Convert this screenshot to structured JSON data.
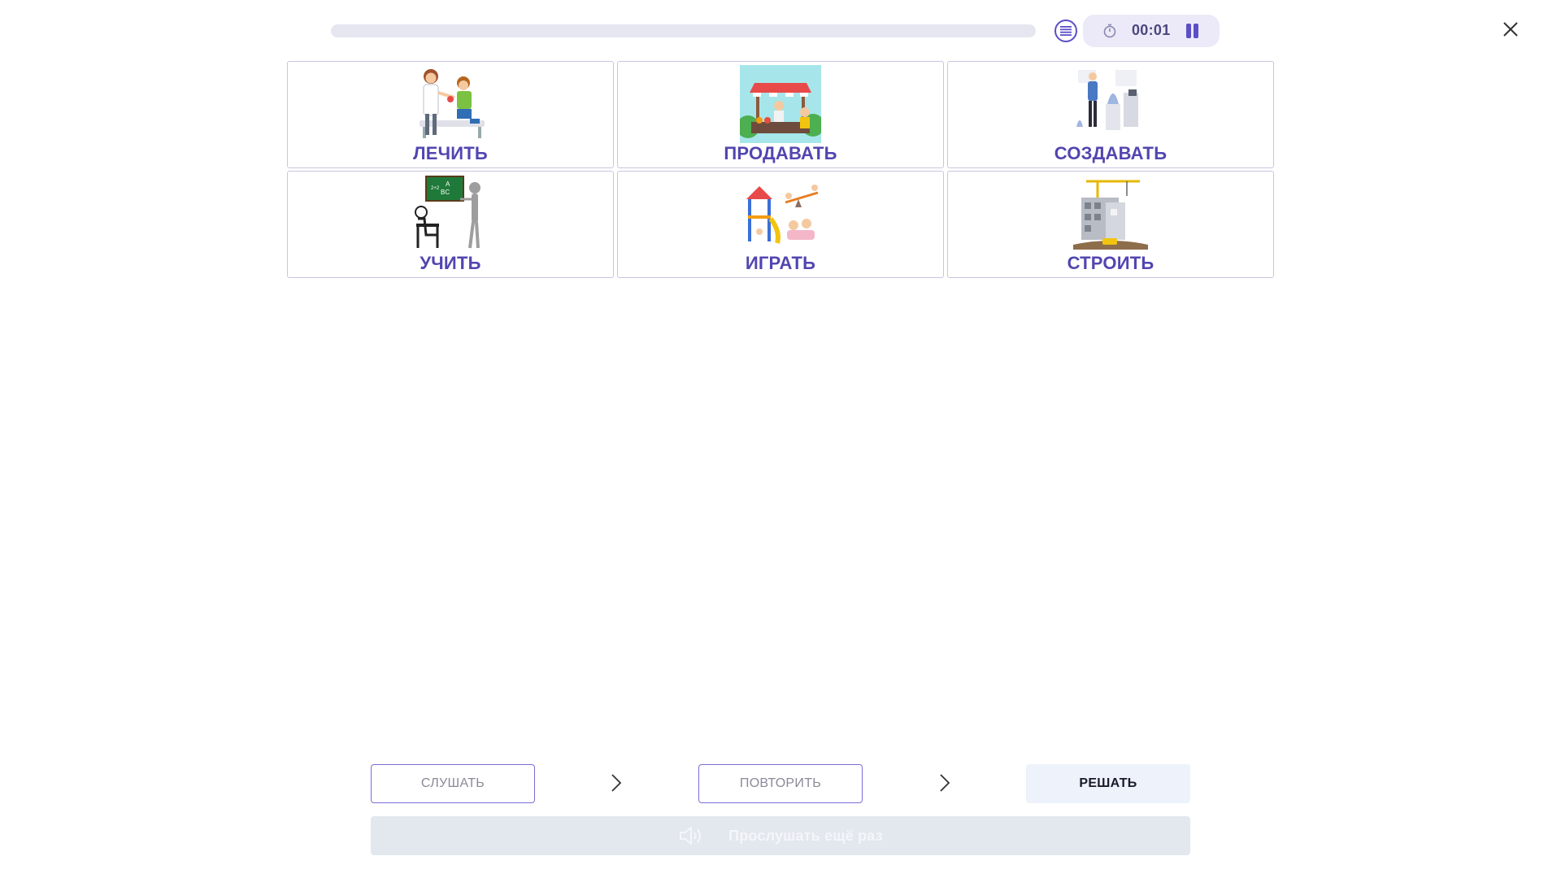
{
  "header": {
    "progress_fraction": 0.0,
    "timer": "00:01",
    "icons": {
      "list": "list-icon",
      "timer": "stopwatch-icon",
      "pause": "pause-icon",
      "close": "close-icon"
    }
  },
  "choices": [
    {
      "label": "ЛЕЧИТЬ",
      "icon": "doctor-treating-child-picture"
    },
    {
      "label": "ПРОДАВАТЬ",
      "icon": "market-stall-picture"
    },
    {
      "label": "СОЗДАВАТЬ",
      "icon": "sculptor-creating-picture"
    },
    {
      "label": "УЧИТЬ",
      "icon": "teacher-at-blackboard-picture"
    },
    {
      "label": "ИГРАТЬ",
      "icon": "children-playground-picture"
    },
    {
      "label": "СТРОИТЬ",
      "icon": "building-crane-picture"
    }
  ],
  "steps": {
    "listen": "СЛУШАТЬ",
    "repeat": "ПОВТОРИТЬ",
    "solve": "РЕШАТЬ"
  },
  "replay": {
    "label": "Прослушать ещё раз",
    "icon": "speaker-icon"
  },
  "colors": {
    "accent": "#5146b0",
    "card_border": "#c9c6e0",
    "timer_bg": "#eceaf8",
    "solve_bg": "#edf2fb",
    "replay_bg": "#e3e7ee"
  }
}
